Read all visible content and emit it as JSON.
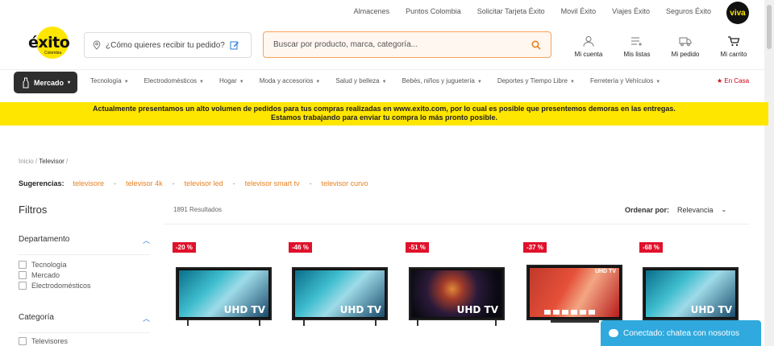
{
  "top_links": [
    "Almacenes",
    "Puntos Colombia",
    "Solicitar Tarjeta Éxito",
    "Movil Éxito",
    "Viajes Éxito",
    "Seguros Éxito"
  ],
  "viva_logo": "viva",
  "logo": {
    "word": "éxito",
    "sub": "Colombia"
  },
  "location": {
    "label": "¿Cómo quieres recibir tu pedido?"
  },
  "search": {
    "placeholder": "Buscar por producto, marca, categoría..."
  },
  "actions": [
    {
      "label": "Mi cuenta",
      "icon": "user-icon"
    },
    {
      "label": "Mis listas",
      "icon": "list-icon"
    },
    {
      "label": "Mi pedido",
      "icon": "truck-icon"
    },
    {
      "label": "Mi carrito",
      "icon": "cart-icon"
    }
  ],
  "nav": {
    "mercado": "Mercado",
    "items": [
      "Tecnología",
      "Electrodomésticos",
      "Hogar",
      "Moda y accesorios",
      "Salud y belleza",
      "Bebés, niños y juguetería",
      "Deportes y Tiempo Libre",
      "Ferretería y Vehículos"
    ],
    "encasa": "En Casa"
  },
  "banner": {
    "line1": "Actualmente presentamos un alto volumen de pedidos para tus compras realizadas en www.exito.com, por lo cual es posible que presentemos demoras en las entregas.",
    "line2": "Estamos trabajando para enviar tu compra lo más pronto posible."
  },
  "breadcrumb": {
    "home": "Inicio",
    "sep": "/",
    "current": "Televisor",
    "trail": "/"
  },
  "suggestions": {
    "label": "Sugerencias:",
    "items": [
      "televisore",
      "televisor 4k",
      "televisor led",
      "televisor smart tv",
      "televisor curvo"
    ],
    "sep": "-"
  },
  "filters": {
    "title": "Filtros",
    "sections": [
      {
        "title": "Departamento",
        "options": [
          "Tecnología",
          "Mercado",
          "Electrodomésticos"
        ]
      },
      {
        "title": "Categoría",
        "options": [
          "Televisores"
        ]
      }
    ]
  },
  "results": "1891 Resultados",
  "sort": {
    "label": "Ordenar por:",
    "value": "Relevancia"
  },
  "products": [
    {
      "discount": "-20 %",
      "tag": "UHD TV",
      "screen": "blue"
    },
    {
      "discount": "-46 %",
      "tag": "UHD TV",
      "screen": "blue"
    },
    {
      "discount": "-51 %",
      "tag": "UHD TV",
      "screen": "dark"
    },
    {
      "discount": "-37 %",
      "tag": "UHD TV",
      "screen": "red"
    },
    {
      "discount": "-68 %",
      "tag": "UHD TV",
      "screen": "blue"
    }
  ],
  "chat": {
    "label": "Conectado: chatea con nosotros"
  },
  "colors": {
    "brand_yellow": "#ffe600",
    "accent_orange": "#e8801f",
    "discount_red": "#e0112b",
    "chat_blue": "#2fa9de"
  }
}
